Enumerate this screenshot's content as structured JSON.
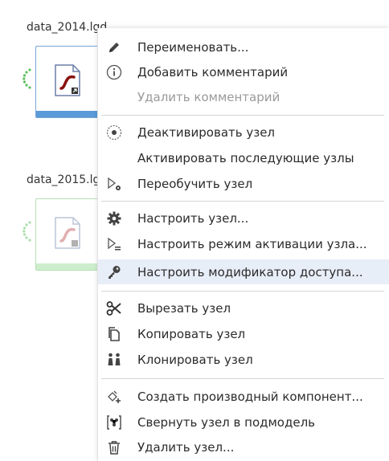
{
  "nodes": [
    {
      "label": "data_2014.lgd"
    },
    {
      "label": "data_2015.lg"
    }
  ],
  "menu": {
    "items": [
      {
        "label": "Переименовать...",
        "icon": "pencil-icon",
        "disabled": false
      },
      {
        "label": "Добавить комментарий",
        "icon": "info-circle-icon",
        "disabled": false
      },
      {
        "label": "Удалить комментарий",
        "icon": "",
        "disabled": true
      },
      {
        "label": "Деактивировать узел",
        "icon": "deactivate-icon",
        "disabled": false
      },
      {
        "label": "Активировать последующие узлы",
        "icon": "",
        "disabled": false
      },
      {
        "label": "Переобучить узел",
        "icon": "retrain-icon",
        "disabled": false
      },
      {
        "label": "Настроить узел...",
        "icon": "gear-icon",
        "disabled": false
      },
      {
        "label": "Настроить режим активации узла...",
        "icon": "activation-mode-icon",
        "disabled": false
      },
      {
        "label": "Настроить модификатор доступа...",
        "icon": "key-icon",
        "disabled": false,
        "highlighted": true
      },
      {
        "label": "Вырезать узел",
        "icon": "scissors-icon",
        "disabled": false
      },
      {
        "label": "Копировать узел",
        "icon": "copy-icon",
        "disabled": false
      },
      {
        "label": "Клонировать узел",
        "icon": "clone-icon",
        "disabled": false
      },
      {
        "label": "Создать производный компонент...",
        "icon": "derived-component-icon",
        "disabled": false
      },
      {
        "label": "Свернуть узел в подмодель",
        "icon": "collapse-submodel-icon",
        "disabled": false
      },
      {
        "label": "Удалить узел...",
        "icon": "trash-icon",
        "disabled": false
      }
    ]
  },
  "colors": {
    "node_border": "#7aa4d6",
    "node_bar": "#5a9ad8",
    "node_port": "#5cc05c",
    "node2_border": "#b6e0b6",
    "menu_highlight": "#e8eef8",
    "icon": "#444444"
  }
}
